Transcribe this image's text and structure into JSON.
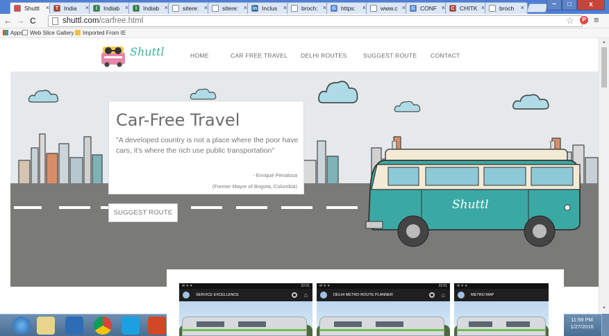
{
  "browser": {
    "tabs": [
      {
        "label": "Shuttl",
        "icon_color": "#e2474b",
        "icon_letter": ""
      },
      {
        "label": "India ",
        "icon_color": "#c0392b",
        "icon_letter": "T"
      },
      {
        "label": "Indiab",
        "icon_color": "#27864a",
        "icon_letter": "I"
      },
      {
        "label": "Indiab",
        "icon_color": "#27864a",
        "icon_letter": "I"
      },
      {
        "label": "sitere:",
        "icon_color": "#ffffff",
        "icon_letter": ""
      },
      {
        "label": "sitere:",
        "icon_color": "#ffffff",
        "icon_letter": ""
      },
      {
        "label": "Inclus",
        "icon_color": "#1f6fb2",
        "icon_letter": "in"
      },
      {
        "label": "broch:",
        "icon_color": "#ffffff",
        "icon_letter": ""
      },
      {
        "label": "https:",
        "icon_color": "#4285f4",
        "icon_letter": "G"
      },
      {
        "label": "www.c",
        "icon_color": "#ffffff",
        "icon_letter": ""
      },
      {
        "label": "CONF",
        "icon_color": "#4285f4",
        "icon_letter": "G"
      },
      {
        "label": "CHITK",
        "icon_color": "#c0392b",
        "icon_letter": "C"
      },
      {
        "label": "broch",
        "icon_color": "#ffffff",
        "icon_letter": ""
      }
    ],
    "close_glyph": "×",
    "window_buttons": {
      "minimize": "−",
      "maximize": "□",
      "close": "x"
    },
    "back": "←",
    "forward": "→",
    "reload": "C",
    "url_host": "shuttl.com",
    "url_path": "/carfree.html",
    "star": "☆",
    "menu": "≡",
    "ext_label": "P",
    "bookmarks": [
      {
        "label": "Apps"
      },
      {
        "label": "Web Slice Gallery"
      },
      {
        "label": "Imported From IE"
      }
    ]
  },
  "site": {
    "logo_text": "Shuttl",
    "nav": [
      "HOME",
      "CAR FREE TRAVEL",
      "DELHI ROUTES",
      "SUGGEST ROUTE",
      "CONTACT"
    ],
    "hero": {
      "title": "Car-Free Travel",
      "quote": "\"A developed country is not a place where the poor have cars, it's where the rich use public transportation\"",
      "author": "- Enrique Penalosa",
      "role": "(Former Mayor of Bogota, Columbia)",
      "button": "SUGGEST ROUTE",
      "van_label": "Shuttl"
    }
  },
  "overlay": {
    "phones": [
      {
        "title": "SERVICE EXCELLENCE",
        "time": "22:01"
      },
      {
        "title": "DELHI METRO ROUTE PLANNER",
        "time": "22:01"
      },
      {
        "title": "METRO MAP",
        "time": ""
      }
    ]
  },
  "taskbar": {
    "time": "11:59 PM",
    "date": "1/27/2016"
  },
  "colors": {
    "van_body": "#3aa9a4",
    "van_roof": "#f2ead4",
    "road": "#7a7a78",
    "accent": "#3bb3a0"
  }
}
